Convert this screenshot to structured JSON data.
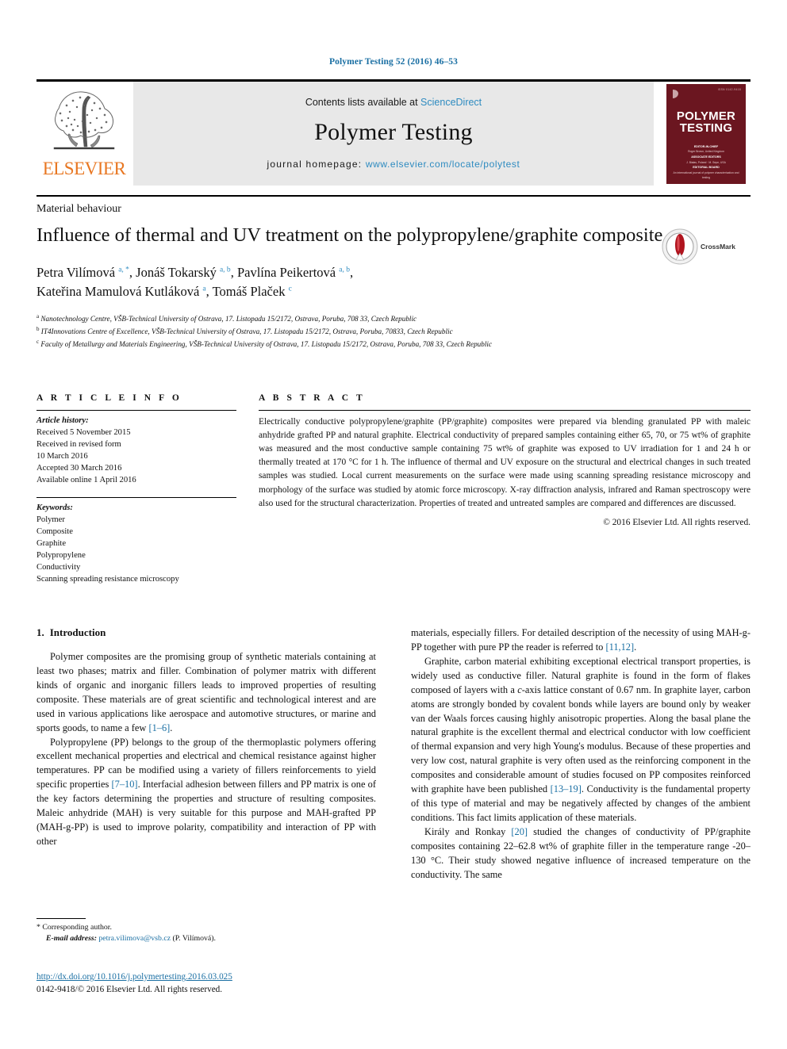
{
  "running_head": "Polymer Testing 52 (2016) 46–53",
  "masthead": {
    "publisher_name": "ELSEVIER",
    "contents_prefix": "Contents lists available at ",
    "contents_link": "ScienceDirect",
    "journal_title": "Polymer Testing",
    "homepage_prefix": "journal homepage: ",
    "homepage_link": "www.elsevier.com/locate/polytest",
    "cover": {
      "title_line1": "POLYMER",
      "title_line2": "TESTING",
      "top_note": "ISSN 0142-9418",
      "editor_block_1": "EDITOR-IN-CHIEF",
      "editor_names_1": "Roger Brown, United Kingdom",
      "editor_block_2": "ASSOCIATE EDITORS",
      "editor_names_2": "J. Białas, Poland · M. Sepe, USA",
      "editor_block_3": "EDITORIAL BOARD",
      "editor_names_3": "An international journal of polymer characterisation and testing"
    }
  },
  "section_label": "Material behaviour",
  "article": {
    "title": "Influence of thermal and UV treatment on the polypropylene/graphite composite",
    "authors_line1_a": "Petra Vilímová ",
    "authors_line1_sup1": "a, *",
    "authors_line1_b": ", Jonáš Tokarský ",
    "authors_line1_sup2": "a, b",
    "authors_line1_c": ", Pavlína Peikertová ",
    "authors_line1_sup3": "a, b",
    "authors_line1_d": ",",
    "authors_line2_a": "Kateřina Mamulová Kutláková ",
    "authors_line2_sup1": "a",
    "authors_line2_b": ", Tomáš Plaček ",
    "authors_line2_sup2": "c",
    "affiliations": [
      {
        "sup": "a",
        "text": "Nanotechnology Centre, VŠB-Technical University of Ostrava, 17. Listopadu 15/2172, Ostrava, Poruba, 708 33, Czech Republic"
      },
      {
        "sup": "b",
        "text": "IT4Innovations Centre of Excellence, VŠB-Technical University of Ostrava, 17. Listopadu 15/2172, Ostrava, Poruba, 70833, Czech Republic"
      },
      {
        "sup": "c",
        "text": "Faculty of Metallurgy and Materials Engineering, VŠB-Technical University of Ostrava, 17. Listopadu 15/2172, Ostrava, Poruba, 708 33, Czech Republic"
      }
    ]
  },
  "crossmark": {
    "label": "CrossMark"
  },
  "article_info": {
    "heading": "A R T I C L E   I N F O",
    "history_label": "Article history:",
    "history": [
      "Received 5 November 2015",
      "Received in revised form",
      "10 March 2016",
      "Accepted 30 March 2016",
      "Available online 1 April 2016"
    ],
    "keywords_label": "Keywords:",
    "keywords": [
      "Polymer",
      "Composite",
      "Graphite",
      "Polypropylene",
      "Conductivity",
      "Scanning spreading resistance microscopy"
    ]
  },
  "abstract": {
    "heading": "A B S T R A C T",
    "text": "Electrically conductive polypropylene/graphite (PP/graphite) composites were prepared via blending granulated PP with maleic anhydride grafted PP and natural graphite. Electrical conductivity of prepared samples containing either 65, 70, or 75 wt% of graphite was measured and the most conductive sample containing 75 wt% of graphite was exposed to UV irradiation for 1 and 24 h or thermally treated at 170 °C for 1 h. The influence of thermal and UV exposure on the structural and electrical changes in such treated samples was studied. Local current measurements on the surface were made using scanning spreading resistance microscopy and morphology of the surface was studied by atomic force microscopy. X-ray diffraction analysis, infrared and Raman spectroscopy were also used for the structural characterization. Properties of treated and untreated samples are compared and differences are discussed.",
    "rights": "© 2016 Elsevier Ltd. All rights reserved."
  },
  "body": {
    "section_number": "1.",
    "section_title": "Introduction",
    "left_p1_a": "Polymer composites are the promising group of synthetic materials containing at least two phases; matrix and filler. Combination of polymer matrix with different kinds of organic and inorganic fillers leads to improved properties of resulting composite. These materials are of great scientific and technological interest and are used in various applications like aerospace and automotive structures, or marine and sports goods, to name a few ",
    "left_p1_ref": "[1–6]",
    "left_p1_b": ".",
    "left_p2_a": "Polypropylene (PP) belongs to the group of the thermoplastic polymers offering excellent mechanical properties and electrical and chemical resistance against higher temperatures. PP can be modified using a variety of fillers reinforcements to yield specific properties ",
    "left_p2_ref": "[7–10]",
    "left_p2_b": ". Interfacial adhesion between fillers and PP matrix is one of the key factors determining the properties and structure of resulting composites. Maleic anhydride (MAH) is very suitable for this purpose and MAH-grafted PP (MAH-g-PP) is used to improve polarity, compatibility and interaction of PP with other",
    "right_p1_a": "materials, especially fillers. For detailed description of the necessity of using MAH-g-PP together with pure PP the reader is referred to ",
    "right_p1_ref": "[11,12]",
    "right_p1_b": ".",
    "right_p2_a": "Graphite, carbon material exhibiting exceptional electrical transport properties, is widely used as conductive filler. Natural graphite is found in the form of flakes composed of layers with a ",
    "right_p2_ital": "c",
    "right_p2_b": "-axis lattice constant of 0.67 nm. In graphite layer, carbon atoms are strongly bonded by covalent bonds while layers are bound only by weaker van der Waals forces causing highly anisotropic properties. Along the basal plane the natural graphite is the excellent thermal and electrical conductor with low coefficient of thermal expansion and very high Young's modulus. Because of these properties and very low cost, natural graphite is very often used as the reinforcing component in the composites and considerable amount of studies focused on PP composites reinforced with graphite have been published ",
    "right_p2_ref": "[13–19]",
    "right_p2_c": ". Conductivity is the fundamental property of this type of material and may be negatively affected by changes of the ambient conditions. This fact limits application of these materials.",
    "right_p3_a": "Király and Ronkay ",
    "right_p3_ref": "[20]",
    "right_p3_b": " studied the changes of conductivity of PP/graphite composites containing 22–62.8 wt% of graphite filler in the temperature range -20–130 °C. Their study showed negative influence of increased temperature on the conductivity. The same"
  },
  "footnote": {
    "corresponding": "* Corresponding author.",
    "email_label": "E-mail address:",
    "email": "petra.vilimova@vsb.cz",
    "email_suffix": "(P. Vilímová)."
  },
  "doi": "http://dx.doi.org/10.1016/j.polymertesting.2016.03.025",
  "copyright": "0142-9418/© 2016 Elsevier Ltd. All rights reserved.",
  "colors": {
    "link_blue": "#2e8bc0",
    "ref_blue": "#1a6fa3",
    "elsevier_orange": "#e87722",
    "cover_maroon": "#6b1620",
    "band_grey": "#e8e8e8"
  }
}
